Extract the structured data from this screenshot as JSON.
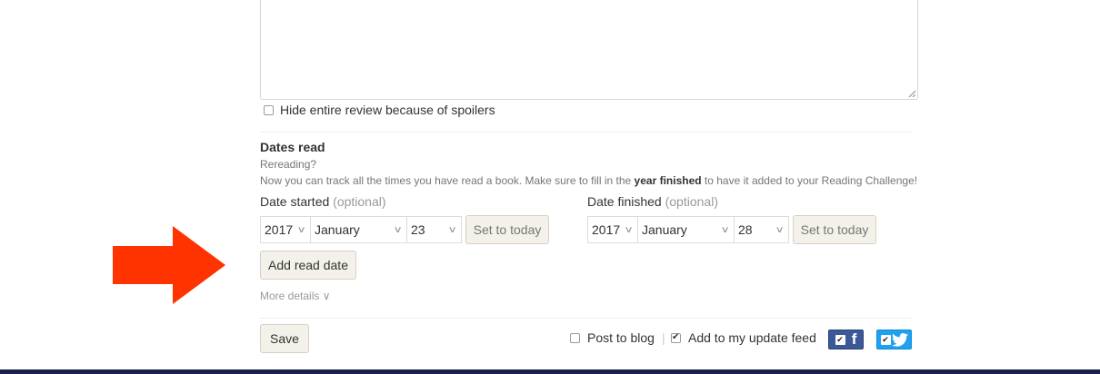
{
  "review": {
    "spoiler_label": "Hide entire review because of spoilers"
  },
  "dates_read": {
    "title": "Dates read",
    "rereading_q": "Rereading?",
    "info_before": "Now you can track all the times you have read a book. Make sure to fill in the ",
    "info_bold": "year finished",
    "info_after": " to have it added to your Reading Challenge!",
    "started": {
      "label": "Date started",
      "optional": "(optional)",
      "year": "2017",
      "month": "January",
      "day": "23",
      "set_today": "Set to today"
    },
    "finished": {
      "label": "Date finished",
      "optional": "(optional)",
      "year": "2017",
      "month": "January",
      "day": "28",
      "set_today": "Set to today"
    },
    "add_read_date": "Add read date",
    "more_details": "More details ∨"
  },
  "footer": {
    "save": "Save",
    "post_to_blog": "Post to blog",
    "separator": "|",
    "add_to_feed": "Add to my update feed",
    "facebook_letter": "f"
  },
  "colors": {
    "arrow": "#ff3300",
    "bottom_bar": "#1d1f4f",
    "facebook": "#3b5998",
    "twitter": "#1da1f2"
  },
  "icons": {
    "arrow": "red-arrow-right-icon",
    "facebook": "facebook-icon",
    "twitter": "twitter-bird-icon"
  }
}
